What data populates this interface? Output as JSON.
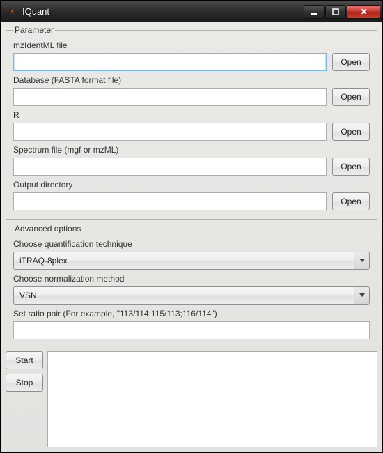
{
  "window": {
    "title": "IQuant"
  },
  "parameter": {
    "legend": "Parameter",
    "mzidentml_label": "mzIdentML file",
    "mzidentml_value": "",
    "database_label": "Database (FASTA format file)",
    "database_value": "",
    "r_label": "R",
    "r_value": "",
    "spectrum_label": "Spectrum file (mgf or mzML)",
    "spectrum_value": "",
    "output_label": "Output directory",
    "output_value": "",
    "open_label": "Open"
  },
  "advanced": {
    "legend": "Advanced options",
    "quant_label": "Choose quantification technique",
    "quant_value": "iTRAQ-8plex",
    "norm_label": "Choose normalization method",
    "norm_value": "VSN",
    "ratio_label": "Set ratio pair (For example, \"113/114;115/113;116/114\")",
    "ratio_value": ""
  },
  "buttons": {
    "start": "Start",
    "stop": "Stop"
  }
}
